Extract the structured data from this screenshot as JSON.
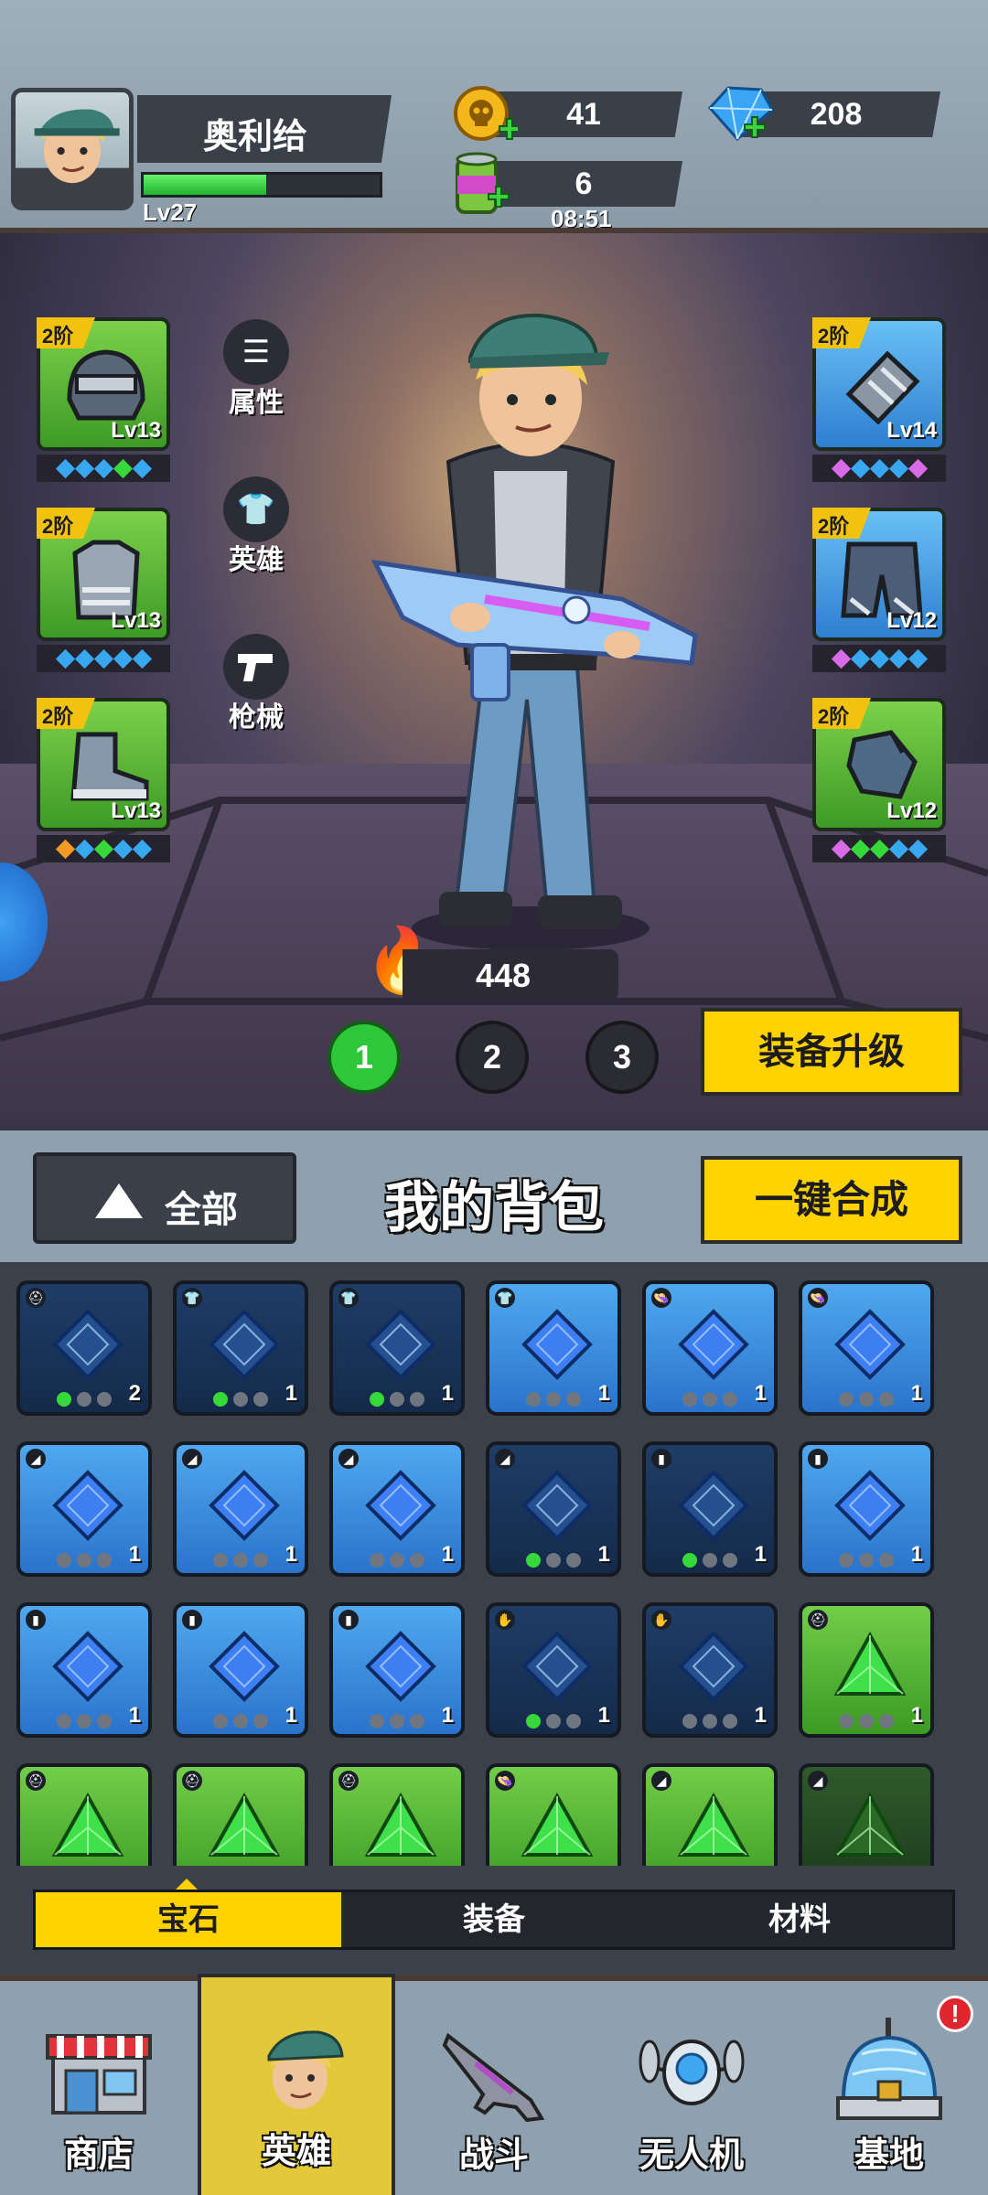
{
  "player": {
    "name": "奥利给",
    "level": "Lv27",
    "xp_fraction": 0.52
  },
  "resources": {
    "coins": "41",
    "gems": "208",
    "energy": "6",
    "energy_timer": "08:51"
  },
  "side_menu": {
    "attributes": "属性",
    "hero": "英雄",
    "weapons": "枪械"
  },
  "equipment": {
    "left": [
      {
        "tier": "2阶",
        "level": "Lv13",
        "icon": "helmet-icon",
        "color": "green",
        "gems": [
          "#38a8f0",
          "#38a8f0",
          "#38a8f0",
          "#36d83a",
          "#38a8f0"
        ]
      },
      {
        "tier": "2阶",
        "level": "Lv13",
        "icon": "armor-icon",
        "color": "green",
        "gems": [
          "#38a8f0",
          "#38a8f0",
          "#38a8f0",
          "#38a8f0",
          "#38a8f0"
        ]
      },
      {
        "tier": "2阶",
        "level": "Lv13",
        "icon": "boots-icon",
        "color": "green",
        "gems": [
          "#f49a24",
          "#38a8f0",
          "#36d83a",
          "#38a8f0",
          "#38a8f0"
        ]
      }
    ],
    "right": [
      {
        "tier": "2阶",
        "level": "Lv14",
        "icon": "bracer-icon",
        "color": "blue",
        "gems": [
          "#d86ce8",
          "#38a8f0",
          "#38a8f0",
          "#38a8f0",
          "#d86ce8"
        ]
      },
      {
        "tier": "2阶",
        "level": "Lv12",
        "icon": "shorts-icon",
        "color": "blue",
        "gems": [
          "#d86ce8",
          "#38a8f0",
          "#38a8f0",
          "#38a8f0",
          "#38a8f0"
        ]
      },
      {
        "tier": "2阶",
        "level": "Lv12",
        "icon": "gloves-icon",
        "color": "green",
        "gems": [
          "#d86ce8",
          "#36d83a",
          "#36d83a",
          "#38a8f0",
          "#38a8f0"
        ]
      }
    ]
  },
  "combat_power": "448",
  "loadouts": [
    "1",
    "2",
    "3"
  ],
  "active_loadout": 0,
  "upgrade_button": "装备升级",
  "backpack": {
    "filter_label": "全部",
    "title": "我的背包",
    "merge_button": "一键合成",
    "items": [
      {
        "style": "dark",
        "gem": "sapphire",
        "count": "2",
        "dots": 1
      },
      {
        "style": "dark",
        "gem": "sapphire",
        "count": "1",
        "dots": 1
      },
      {
        "style": "dark",
        "gem": "sapphire",
        "count": "1",
        "dots": 1
      },
      {
        "style": "blue",
        "gem": "sapphire",
        "count": "1",
        "dots": 0
      },
      {
        "style": "blue",
        "gem": "sapphire",
        "count": "1",
        "dots": 0
      },
      {
        "style": "blue",
        "gem": "sapphire",
        "count": "1",
        "dots": 0
      },
      {
        "style": "blue",
        "gem": "sapphire",
        "count": "1",
        "dots": 0
      },
      {
        "style": "blue",
        "gem": "sapphire",
        "count": "1",
        "dots": 0
      },
      {
        "style": "blue",
        "gem": "sapphire",
        "count": "1",
        "dots": 0
      },
      {
        "style": "dark",
        "gem": "sapphire",
        "count": "1",
        "dots": 1
      },
      {
        "style": "dark",
        "gem": "sapphire",
        "count": "1",
        "dots": 1
      },
      {
        "style": "blue",
        "gem": "sapphire",
        "count": "1",
        "dots": 0
      },
      {
        "style": "blue",
        "gem": "sapphire",
        "count": "1",
        "dots": 0
      },
      {
        "style": "blue",
        "gem": "sapphire",
        "count": "1",
        "dots": 0
      },
      {
        "style": "blue",
        "gem": "sapphire",
        "count": "1",
        "dots": 0
      },
      {
        "style": "dark",
        "gem": "sapphire",
        "count": "1",
        "dots": 1
      },
      {
        "style": "dark",
        "gem": "sapphire",
        "count": "1",
        "dots": 0
      },
      {
        "style": "green",
        "gem": "emerald",
        "count": "1",
        "dots": 0
      },
      {
        "style": "green",
        "gem": "emerald",
        "count": "",
        "dots": 0
      },
      {
        "style": "green",
        "gem": "emerald",
        "count": "",
        "dots": 0
      },
      {
        "style": "green",
        "gem": "emerald",
        "count": "",
        "dots": 0
      },
      {
        "style": "green",
        "gem": "emerald",
        "count": "",
        "dots": 0
      },
      {
        "style": "green",
        "gem": "emerald",
        "count": "",
        "dots": 0
      },
      {
        "style": "dgreen",
        "gem": "emerald",
        "count": "",
        "dots": 0
      }
    ]
  },
  "tabs": {
    "gems": "宝石",
    "equipment": "装备",
    "materials": "材料"
  },
  "nav": {
    "shop": "商店",
    "hero": "英雄",
    "battle": "战斗",
    "drone": "无人机",
    "base": "基地",
    "alert": "!"
  }
}
